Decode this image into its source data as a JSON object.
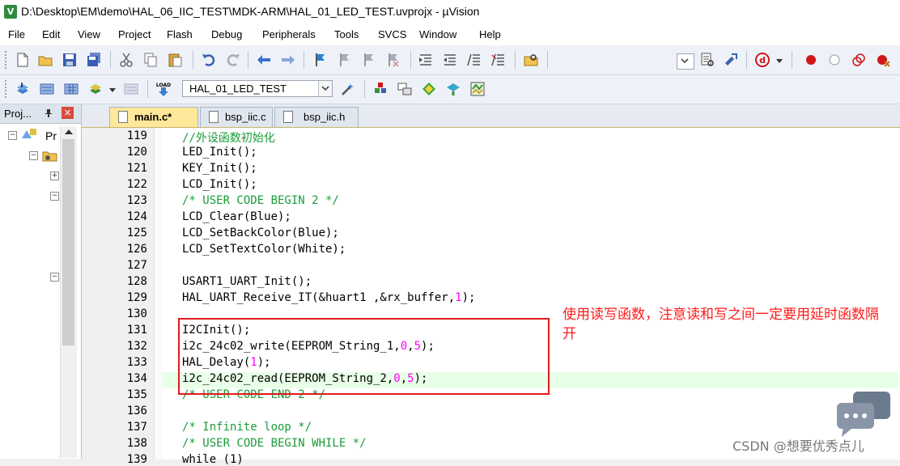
{
  "window": {
    "title": "D:\\Desktop\\EM\\demo\\HAL_06_IIC_TEST\\MDK-ARM\\HAL_01_LED_TEST.uvprojx - µVision",
    "logo": "V"
  },
  "menu": [
    "File",
    "Edit",
    "View",
    "Project",
    "Flash",
    "Debug",
    "Peripherals",
    "Tools",
    "SVCS",
    "Window",
    "Help"
  ],
  "toolbar2": {
    "target": "HAL_01_LED_TEST",
    "load_label": "LOAD"
  },
  "project_panel": {
    "title": "Proj...",
    "root_label": "Pr"
  },
  "tabs": [
    "main.c*",
    "bsp_iic.c",
    "bsp_iic.h"
  ],
  "editor": {
    "lines": [
      {
        "n": "119",
        "t": "//外设函数初始化",
        "kind": "comment"
      },
      {
        "n": "120",
        "t": "LED_Init();"
      },
      {
        "n": "121",
        "t": "KEY_Init();"
      },
      {
        "n": "122",
        "t": "LCD_Init();"
      },
      {
        "n": "123",
        "t": "/* USER CODE BEGIN 2 */",
        "kind": "comment"
      },
      {
        "n": "124",
        "t": "LCD_Clear(Blue);"
      },
      {
        "n": "125",
        "t": "LCD_SetBackColor(Blue);"
      },
      {
        "n": "126",
        "t": "LCD_SetTextColor(White);"
      },
      {
        "n": "127",
        "t": ""
      },
      {
        "n": "128",
        "t": "USART1_UART_Init();"
      },
      {
        "n": "129",
        "parts": [
          [
            "HAL_UART_Receive_IT(&huart1 ,&rx_buffer,",
            ""
          ],
          [
            "1",
            "num"
          ],
          [
            ");",
            ""
          ]
        ]
      },
      {
        "n": "130",
        "t": ""
      },
      {
        "n": "131",
        "t": "I2CInit();"
      },
      {
        "n": "132",
        "parts": [
          [
            "i2c_24c02_write(EEPROM_String_1,",
            ""
          ],
          [
            "0",
            "num"
          ],
          [
            ",",
            ""
          ],
          [
            "5",
            "num"
          ],
          [
            ");",
            ""
          ]
        ]
      },
      {
        "n": "133",
        "parts": [
          [
            "HAL_Delay(",
            ""
          ],
          [
            "1",
            "num"
          ],
          [
            ");",
            ""
          ]
        ]
      },
      {
        "n": "134",
        "parts": [
          [
            "i2c_24c02_read(EEPROM_String_2,",
            ""
          ],
          [
            "0",
            "num"
          ],
          [
            ",",
            ""
          ],
          [
            "5",
            "num"
          ],
          [
            ");",
            ""
          ]
        ]
      },
      {
        "n": "135",
        "t": "/* USER CODE END 2 */",
        "kind": "comment"
      },
      {
        "n": "136",
        "t": ""
      },
      {
        "n": "137",
        "t": "/* Infinite loop */",
        "kind": "comment"
      },
      {
        "n": "138",
        "t": "/* USER CODE BEGIN WHILE */",
        "kind": "comment"
      },
      {
        "n": "139",
        "t": "while (1)"
      }
    ]
  },
  "annotation": {
    "text": "使用读写函数，注意读和写之间一定要用延时函数隔开"
  },
  "watermark": "CSDN @想要优秀点儿",
  "colors": {
    "comment": "#1a9c3a",
    "number": "#ff00ff",
    "annotation": "#e01b1b"
  }
}
